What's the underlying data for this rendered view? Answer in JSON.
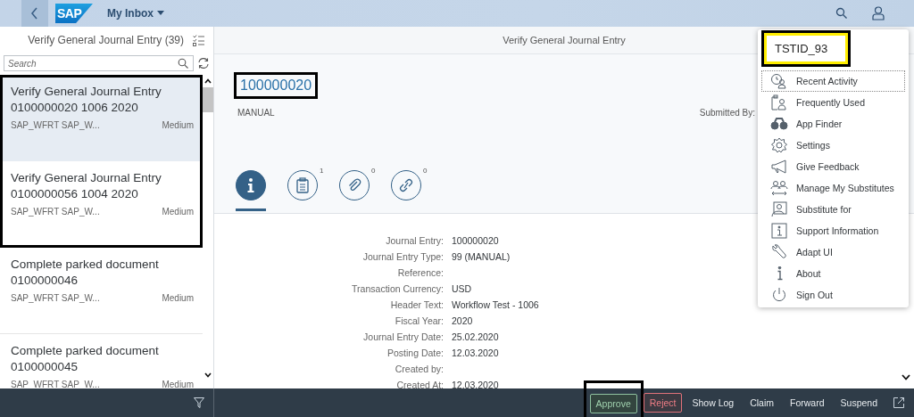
{
  "shell": {
    "logo_text": "SAP",
    "title": "My Inbox"
  },
  "master": {
    "title": "Verify General Journal Entry (39)",
    "search": {
      "placeholder": "Search"
    },
    "tasks": [
      {
        "title": "Verify General Journal Entry 0100000020 1006 2020",
        "creator": "SAP_WFRT SAP_W...",
        "priority": "Medium",
        "selected": true,
        "highlighted": true
      },
      {
        "title": "Verify General Journal Entry 0100000056 1004 2020",
        "creator": "SAP_WFRT SAP_W...",
        "priority": "Medium",
        "selected": false,
        "highlighted": true
      },
      {
        "title": "Complete parked document 0100000046",
        "creator": "SAP_WFRT SAP_W...",
        "priority": "Medium",
        "selected": false,
        "highlighted": false
      },
      {
        "title": "Complete parked document 0100000045",
        "creator": "SAP_WFRT SAP_W...",
        "priority": "Medium",
        "selected": false,
        "highlighted": false
      }
    ]
  },
  "detail": {
    "title": "Verify General Journal Entry",
    "object_id": "100000020",
    "object_id_highlighted": true,
    "subtitle": "MANUAL",
    "submitted_by_label": "Submitted By:",
    "tabs": [
      {
        "selected": true
      },
      {
        "count": "1",
        "selected": false
      },
      {
        "count": "0",
        "selected": false
      },
      {
        "count": "0",
        "selected": false
      }
    ],
    "fields": [
      {
        "label": "Journal Entry:",
        "value": "100000020"
      },
      {
        "label": "Journal Entry Type:",
        "value": "99 (MANUAL)"
      },
      {
        "label": "Reference:"
      },
      {
        "label": "Transaction Currency:",
        "value": "USD"
      },
      {
        "label": "Header Text:",
        "value": "Workflow Test - 1006"
      },
      {
        "label": "Fiscal Year:",
        "value": "2020"
      },
      {
        "label": "Journal Entry Date:",
        "value": "25.02.2020"
      },
      {
        "label": "Posting Date:",
        "value": "12.03.2020"
      },
      {
        "label": "Created by:"
      },
      {
        "label": "Created At:",
        "value": "12.03.2020"
      }
    ]
  },
  "footer_buttons": [
    {
      "label": "Approve",
      "kind": "accept",
      "highlighted": true
    },
    {
      "label": "Reject",
      "kind": "reject",
      "highlighted": false
    },
    {
      "label": "Show Log",
      "kind": "plain",
      "highlighted": false
    },
    {
      "label": "Claim",
      "kind": "plain",
      "highlighted": false
    },
    {
      "label": "Forward",
      "kind": "plain",
      "highlighted": false
    },
    {
      "label": "Suspend",
      "kind": "plain",
      "highlighted": false
    }
  ],
  "user_menu": {
    "user_id": "TSTID_93",
    "user_id_highlighted": true,
    "items": [
      {
        "label": "Recent Activity",
        "focused": true
      },
      {
        "label": "Frequently Used",
        "focused": false
      },
      {
        "label": "App Finder",
        "focused": false
      },
      {
        "label": "Settings",
        "focused": false
      },
      {
        "label": "Give Feedback",
        "focused": false
      },
      {
        "label": "Manage My Substitutes",
        "focused": false
      },
      {
        "label": "Substitute for",
        "focused": false
      },
      {
        "label": "Support Information",
        "focused": false
      },
      {
        "label": "Adapt UI",
        "focused": false
      },
      {
        "label": "About",
        "focused": false
      },
      {
        "label": "Sign Out",
        "focused": false
      }
    ]
  }
}
